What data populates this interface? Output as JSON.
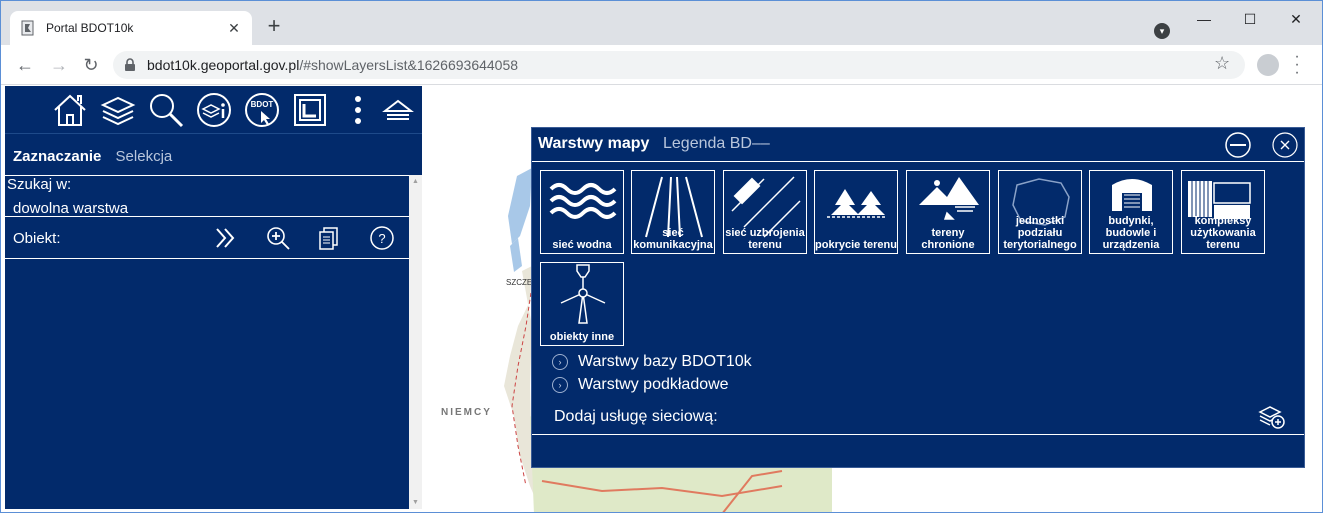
{
  "browser": {
    "tab_title": "Portal BDOT10k",
    "tab_close": "✕",
    "new_tab": "+",
    "url_host": "bdot10k.geoportal.gov.pl",
    "url_path": "/#showLayersList&1626693644058",
    "window_controls": {
      "minimize": "—",
      "maximize": "☐",
      "close": "✕"
    },
    "nav": {
      "back": "←",
      "forward": "→",
      "reload": "↻"
    },
    "star": "☆"
  },
  "left_panel": {
    "modes": {
      "active": "Zaznaczanie",
      "inactive": "Selekcja"
    },
    "search_label": "Szukaj w:",
    "search_value": "dowolna warstwa",
    "object_label": "Obiekt:",
    "top_icons": [
      "home-icon",
      "layers-icon",
      "search-icon",
      "info-icon",
      "bdot-icon",
      "frame-icon",
      "more-icon",
      "collapse-icon"
    ],
    "bdot_icon_text": "BDOT"
  },
  "map": {
    "labels": {
      "city": "SZCZE",
      "country": "NIEMCY"
    }
  },
  "dialog": {
    "tab_active": "Warstwy mapy",
    "tab_inactive": "Legenda BD––",
    "tiles": [
      {
        "label": "sieć wodna",
        "icon": "water-icon"
      },
      {
        "label": "sieć komunikacyjna",
        "icon": "road-icon"
      },
      {
        "label": "sieć uzbrojenia terenu",
        "icon": "utility-network-icon"
      },
      {
        "label": "pokrycie terenu",
        "icon": "forest-icon"
      },
      {
        "label": "tereny chronione",
        "icon": "protected-area-icon"
      },
      {
        "label": "jednostki podziału terytorialnego",
        "icon": "territorial-units-icon"
      },
      {
        "label": "budynki, budowle i urządzenia",
        "icon": "building-icon"
      },
      {
        "label": "kompleksy użytkowania terenu",
        "icon": "land-use-icon"
      },
      {
        "label": "obiekty inne",
        "icon": "windmill-icon"
      }
    ],
    "tree": [
      {
        "label": "Warstwy bazy BDOT10k"
      },
      {
        "label": "Warstwy podkładowe"
      }
    ],
    "tree_chevron": "›",
    "add_service": "Dodaj usługę sieciową:"
  },
  "colors": {
    "panel": "#022a6b",
    "chrome": "#dee1e6",
    "omnibox": "#f1f3f4"
  }
}
